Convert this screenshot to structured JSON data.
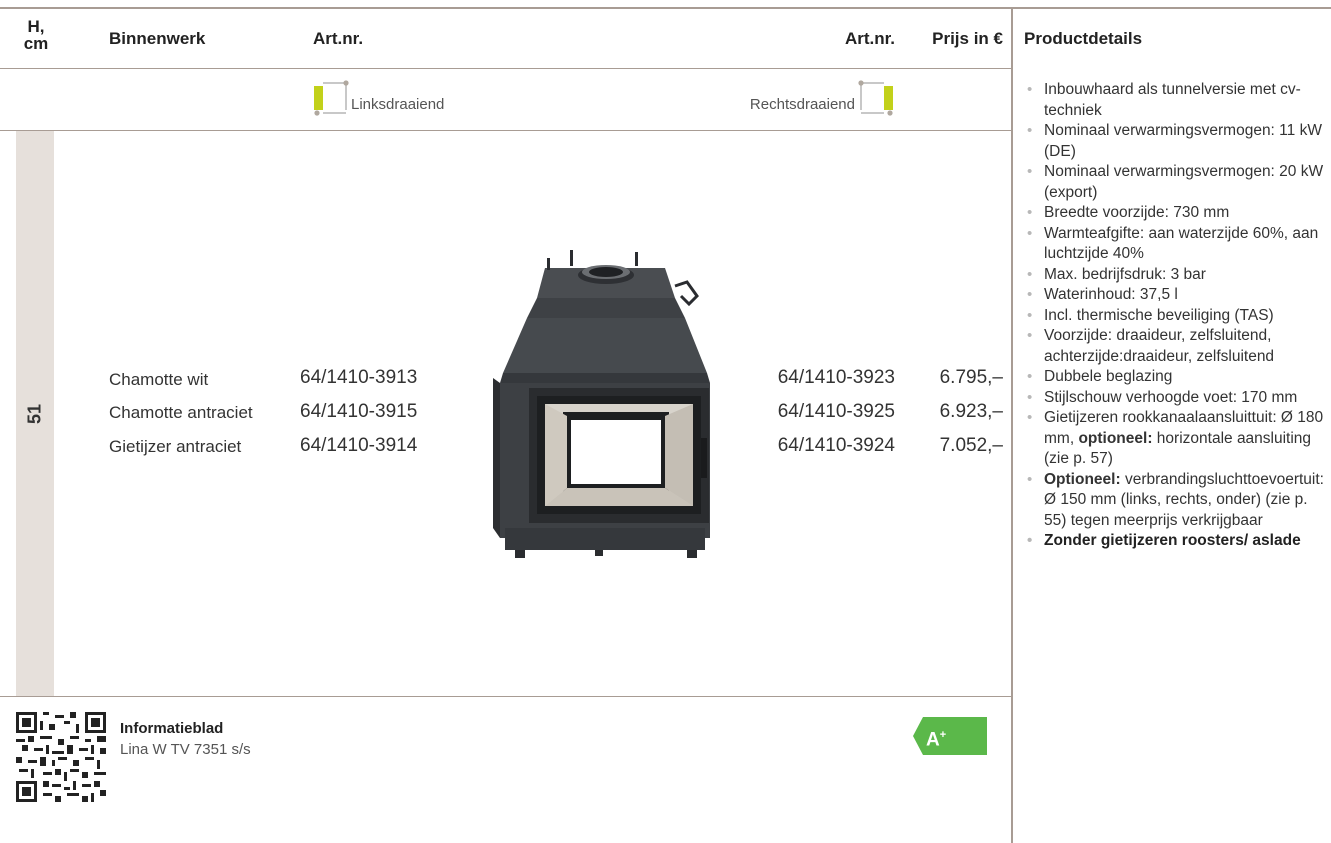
{
  "header": {
    "col_h": "H,\ncm",
    "col_binnenwerk": "Binnenwerk",
    "col_artnr_left": "Art.nr.",
    "col_artnr_right": "Art.nr.",
    "col_prijs": "Prijs in €",
    "col_details": "Productdetails"
  },
  "orientation": {
    "left_label": "Linksdraaiend",
    "right_label": "Rechtsdraaiend"
  },
  "height_value": "51",
  "rows": [
    {
      "binnenwerk": "Chamotte wit",
      "artnr_left": "64/1410-3913",
      "artnr_right": "64/1410-3923",
      "prijs": "6.795,–"
    },
    {
      "binnenwerk": "Chamotte antraciet",
      "artnr_left": "64/1410-3915",
      "artnr_right": "64/1410-3925",
      "prijs": "6.923,–"
    },
    {
      "binnenwerk": "Gietijzer antraciet",
      "artnr_left": "64/1410-3914",
      "artnr_right": "64/1410-3924",
      "prijs": "7.052,–"
    }
  ],
  "details": [
    {
      "text": "Inbouwhaard als tunnelversie met cv-techniek"
    },
    {
      "text": "Nominaal verwarmingsvermogen: 11 kW (DE)"
    },
    {
      "text": "Nominaal verwarmingsvermogen: 20 kW (export)"
    },
    {
      "text": "Breedte voorzijde: 730 mm"
    },
    {
      "text": "Warmteafgifte: aan waterzijde 60%, aan luchtzijde 40%"
    },
    {
      "text": "Max. bedrijfsdruk: 3 bar"
    },
    {
      "text": "Waterinhoud: 37,5 l"
    },
    {
      "text": "Incl. thermische beveiliging (TAS)"
    },
    {
      "text": "Voorzijde: draaideur, zelfsluitend, achterzijde:draaideur, zelfsluitend"
    },
    {
      "text": "Dubbele beglazing"
    },
    {
      "text": "Stijlschouw verhoogde voet: 170 mm"
    },
    {
      "pre": "Gietijzeren rookkanaalaansluittuit: Ø 180 mm, ",
      "bold": "optioneel:",
      "post": " horizontale aansluiting (zie p. 57)"
    },
    {
      "bold": "Optioneel:",
      "post": " verbrandingsluchttoevoertuit: Ø 150 mm (links, rechts, onder) (zie p. 55) tegen meerprijs verkrijgbaar"
    },
    {
      "text": "Zonder gietijzeren roosters/ aslade",
      "is_bold": true
    }
  ],
  "footer": {
    "info_title": "Informatieblad",
    "info_subtitle": "Lina W TV 7351 s/s",
    "energy_label": "A",
    "energy_sup": "+",
    "energy_color": "#5bb84a"
  },
  "colors": {
    "rule": "#a89c94",
    "height_cell": "#e6e0db",
    "icon_door": "#c2d11a"
  }
}
